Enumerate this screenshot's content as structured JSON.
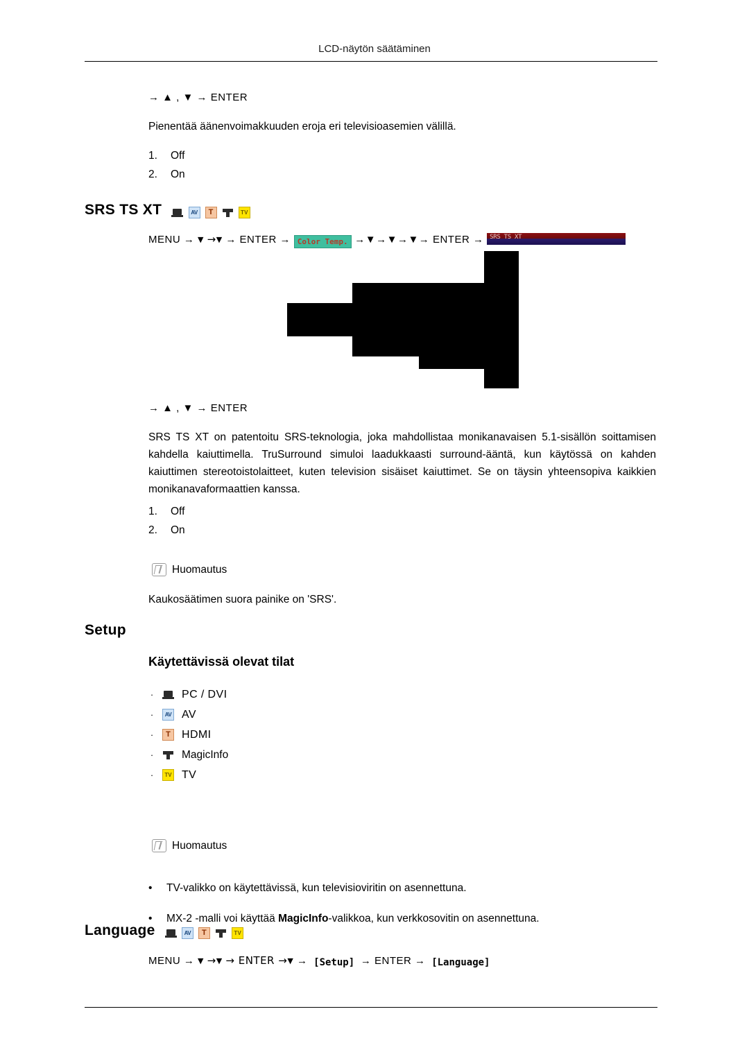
{
  "header": {
    "title": "LCD-näytön säätäminen"
  },
  "auto_volume": {
    "nav1": "→ ▲ , ▼ → ENTER",
    "description": "Pienentää äänenvoimakkuuden eroja eri televisioasemien välillä.",
    "options": [
      {
        "num": "1.",
        "label": "Off"
      },
      {
        "num": "2.",
        "label": "On"
      }
    ]
  },
  "srs": {
    "heading": "SRS TS XT",
    "icons": [
      "pc-dvi-icon",
      "av-icon",
      "hdmi-icon",
      "magicinfo-icon",
      "tv-icon"
    ],
    "menu_path": {
      "prefix": "MENU →",
      "d1": "▼",
      "arrow1": "→",
      "d2": "▼",
      "arrow2": "→ ENTER →",
      "chip_color_temp": "Color Temp.",
      "mid": "→▼→▼→▼→ ENTER →",
      "chip_red_label": "SRS TS XT"
    },
    "nav2": "→ ▲ , ▼ → ENTER",
    "paragraph": "SRS TS XT on patentoitu SRS-teknologia, joka mahdollistaa monikanavaisen 5.1-sisällön soittamisen kahdella kaiuttimella. TruSurround simuloi laadukkaasti surround-ääntä, kun käytössä on kahden kaiuttimen stereotoistolaitteet, kuten television sisäiset kaiuttimet. Se on täysin yhteensopiva kaikkien monikanavaformaattien kanssa.",
    "options": [
      {
        "num": "1.",
        "label": "Off"
      },
      {
        "num": "2.",
        "label": "On"
      }
    ],
    "note_label": "Huomautus",
    "note_text": "Kaukosäätimen suora painike on 'SRS'."
  },
  "setup": {
    "heading": "Setup",
    "subheading": "Käytettävissä olevat tilat",
    "modes": [
      {
        "icon": "pc-dvi-icon",
        "label": "PC / DVI"
      },
      {
        "icon": "av-icon",
        "label": "AV"
      },
      {
        "icon": "hdmi-icon",
        "label": "HDMI"
      },
      {
        "icon": "magicinfo-icon",
        "label": "MagicInfo"
      },
      {
        "icon": "tv-icon",
        "label": "TV"
      }
    ],
    "note_label": "Huomautus",
    "notes": [
      "TV-valikko on käytettävissä, kun televisioviritin on asennettuna.",
      "MX-2 -malli voi käyttää MagicInfo-valikkoa, kun verkkosovitin on asennettuna."
    ],
    "note2_pre": "MX-2 -malli voi käyttää ",
    "note2_bold": "MagicInfo",
    "note2_post": "-valikkoa, kun verkkosovitin on asennettuna."
  },
  "language": {
    "heading": "Language",
    "icons": [
      "pc-dvi-icon",
      "av-icon",
      "hdmi-icon",
      "magicinfo-icon",
      "tv-icon"
    ],
    "menu_path": {
      "prefix": "MENU →",
      "d1": "▼",
      "arrow1": "→",
      "d2": "▼",
      "arrow2": "→",
      "d3": "▼",
      "arrow3": "→ ENTER →",
      "chip_setup": "Setup",
      "mid": "→ ENTER →",
      "chip_language": "[Language]"
    }
  },
  "icon_labels": {
    "av": "AV",
    "hdmi": "T",
    "tv": "TV"
  }
}
